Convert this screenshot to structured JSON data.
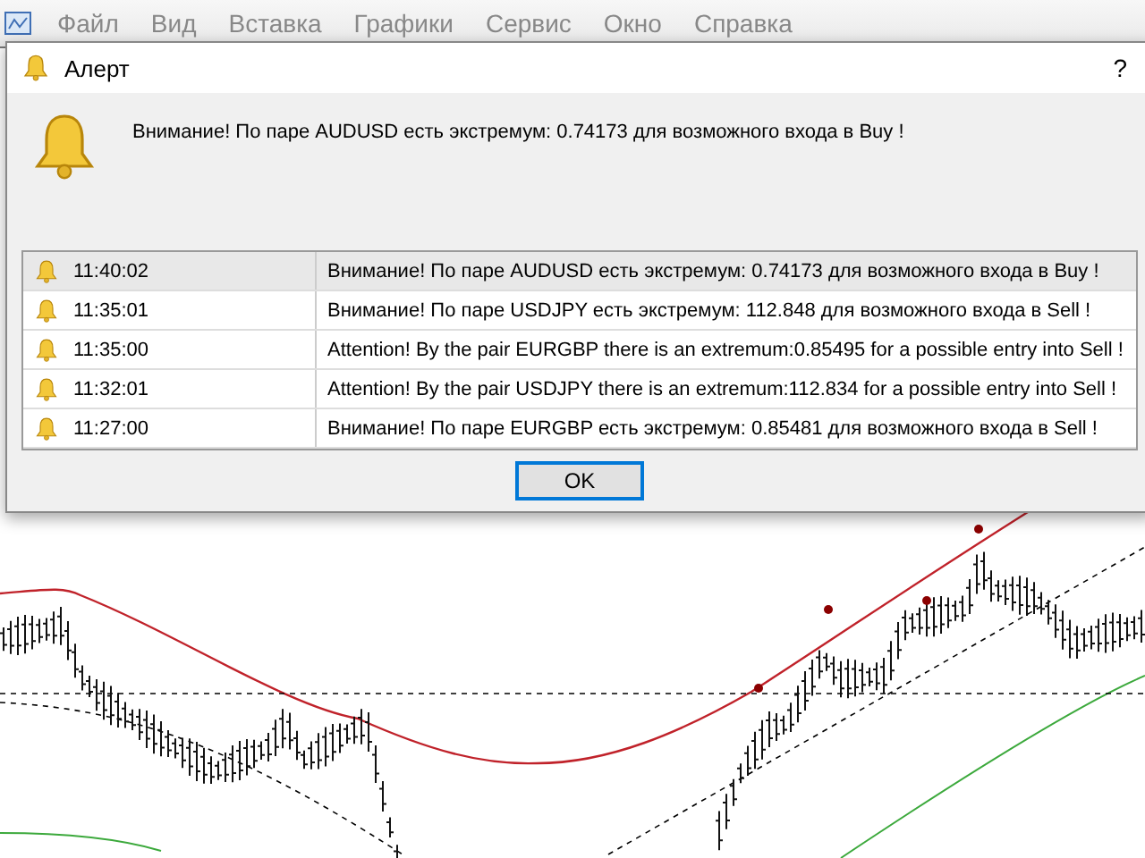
{
  "menu_bar": {
    "items": [
      "Файл",
      "Вид",
      "Вставка",
      "Графики",
      "Сервис",
      "Окно",
      "Справка"
    ]
  },
  "dialog": {
    "title": "Алерт",
    "help": "?",
    "message": "Внимание! По паре AUDUSD есть экстремум: 0.74173 для возможного входа в Buy !",
    "alerts": [
      {
        "time": "11:40:02",
        "text": "Внимание! По паре AUDUSD есть экстремум: 0.74173 для возможного входа в Buy !",
        "selected": true
      },
      {
        "time": "11:35:01",
        "text": "Внимание! По паре USDJPY есть экстремум: 112.848 для возможного входа в Sell !",
        "selected": false
      },
      {
        "time": "11:35:00",
        "text": "Attention! By the pair EURGBP there is an extremum:0.85495 for a possible entry into Sell !",
        "selected": false
      },
      {
        "time": "11:32:01",
        "text": "Attention! By the pair USDJPY there is an extremum:112.834 for a possible entry into Sell !",
        "selected": false
      },
      {
        "time": "11:27:00",
        "text": "Внимание! По паре EURGBP есть экстремум: 0.85481 для возможного входа в Sell !",
        "selected": false
      }
    ],
    "ok_button": "OK"
  }
}
